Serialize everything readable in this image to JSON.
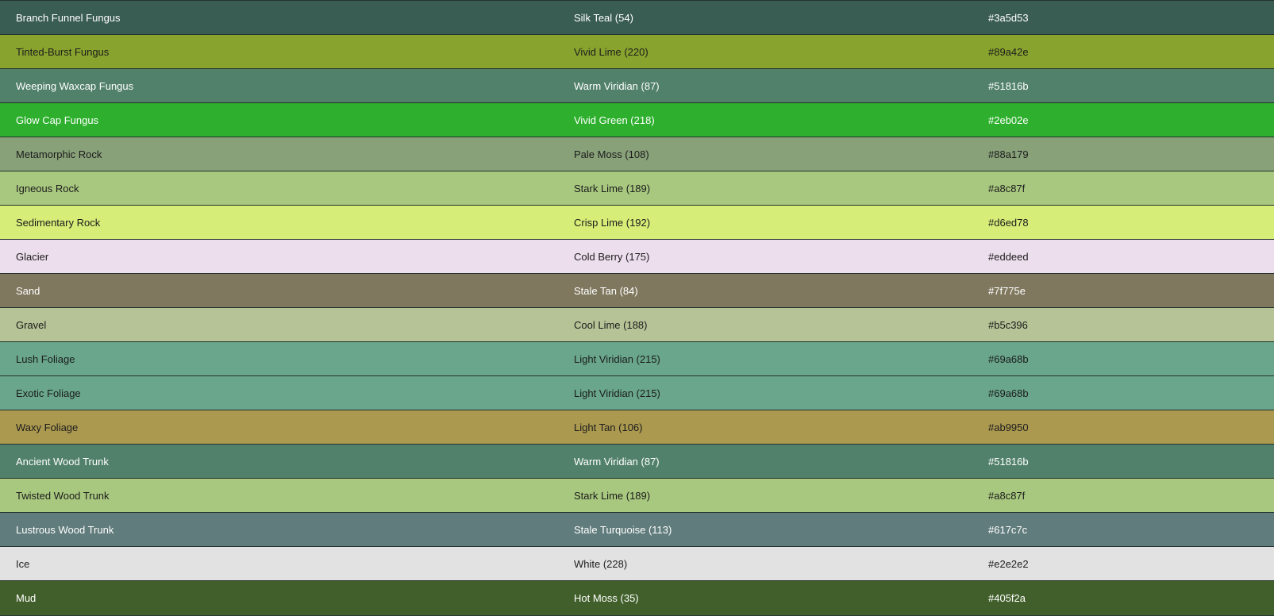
{
  "rows": [
    {
      "name": "Branch Funnel Fungus",
      "description": "Silk Teal (54)",
      "hex": "#3a5d53",
      "text": "light"
    },
    {
      "name": "Tinted-Burst Fungus",
      "description": "Vivid Lime (220)",
      "hex": "#89a42e",
      "text": "dark"
    },
    {
      "name": "Weeping Waxcap Fungus",
      "description": "Warm Viridian (87)",
      "hex": "#51816b",
      "text": "light"
    },
    {
      "name": "Glow Cap Fungus",
      "description": "Vivid Green (218)",
      "hex": "#2eb02e",
      "text": "light"
    },
    {
      "name": "Metamorphic Rock",
      "description": "Pale Moss (108)",
      "hex": "#88a179",
      "text": "dark"
    },
    {
      "name": "Igneous Rock",
      "description": "Stark Lime (189)",
      "hex": "#a8c87f",
      "text": "dark"
    },
    {
      "name": "Sedimentary Rock",
      "description": "Crisp Lime (192)",
      "hex": "#d6ed78",
      "text": "dark"
    },
    {
      "name": "Glacier",
      "description": "Cold Berry (175)",
      "hex": "#eddeed",
      "text": "dark"
    },
    {
      "name": "Sand",
      "description": "Stale Tan (84)",
      "hex": "#7f775e",
      "text": "light"
    },
    {
      "name": "Gravel",
      "description": "Cool Lime (188)",
      "hex": "#b5c396",
      "text": "dark"
    },
    {
      "name": "Lush Foliage",
      "description": "Light Viridian (215)",
      "hex": "#69a68b",
      "text": "dark"
    },
    {
      "name": "Exotic Foliage",
      "description": "Light Viridian (215)",
      "hex": "#69a68b",
      "text": "dark"
    },
    {
      "name": "Waxy Foliage",
      "description": "Light Tan (106)",
      "hex": "#ab9950",
      "text": "dark"
    },
    {
      "name": "Ancient Wood Trunk",
      "description": "Warm Viridian (87)",
      "hex": "#51816b",
      "text": "light"
    },
    {
      "name": "Twisted Wood Trunk",
      "description": "Stark Lime (189)",
      "hex": "#a8c87f",
      "text": "dark"
    },
    {
      "name": "Lustrous Wood Trunk",
      "description": "Stale Turquoise (113)",
      "hex": "#617c7c",
      "text": "light"
    },
    {
      "name": "Ice",
      "description": "White (228)",
      "hex": "#e2e2e2",
      "text": "dark"
    },
    {
      "name": "Mud",
      "description": "Hot Moss (35)",
      "hex": "#405f2a",
      "text": "light"
    }
  ]
}
